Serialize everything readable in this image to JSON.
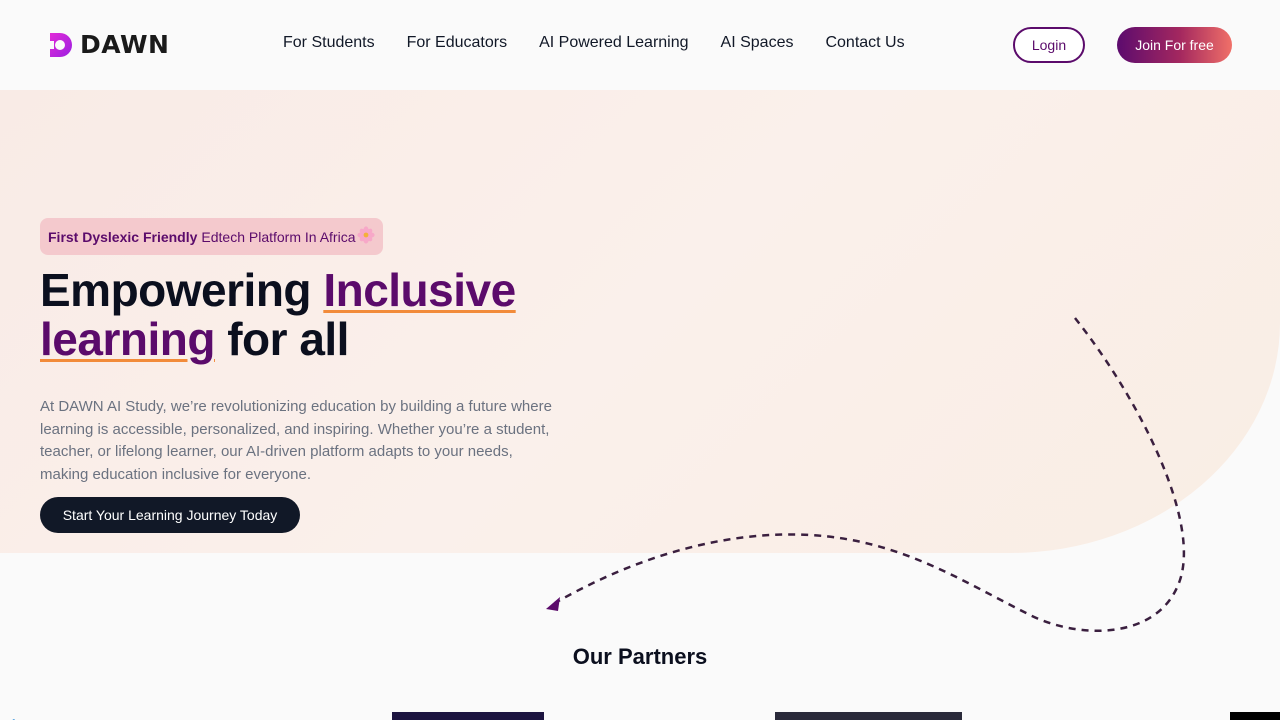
{
  "brand": {
    "name": "DAWN"
  },
  "nav": {
    "items": [
      "For Students",
      "For Educators",
      "AI Powered Learning",
      "AI Spaces",
      "Contact Us"
    ]
  },
  "header": {
    "login_label": "Login",
    "join_label": "Join For free"
  },
  "hero": {
    "tagline_bold": "First Dyslexic Friendly",
    "tagline_rest": "Edtech Platform In Africa",
    "headline_part1": "Empowering ",
    "headline_highlight1": "Inclusive",
    "headline_highlight2": "learning",
    "headline_part2": " for all",
    "lead": "At DAWN AI Study, we’re revolutionizing education by building a future where learning is accessible, personalized, and inspiring. Whether you’re a student, teacher, or lifelong learner, our AI-driven platform adapts to your needs, making education inclusive for everyone.",
    "cta_label": "Start Your Learning Journey Today"
  },
  "partners": {
    "title": "Our Partners"
  },
  "colors": {
    "brand_purple": "#5b0b6b",
    "accent_orange": "#f28b3a",
    "dark": "#111827"
  },
  "icons": {
    "logo": "dawn-logo-icon",
    "tagline": "flower-icon",
    "decoration": "dashed-arrow-icon"
  }
}
